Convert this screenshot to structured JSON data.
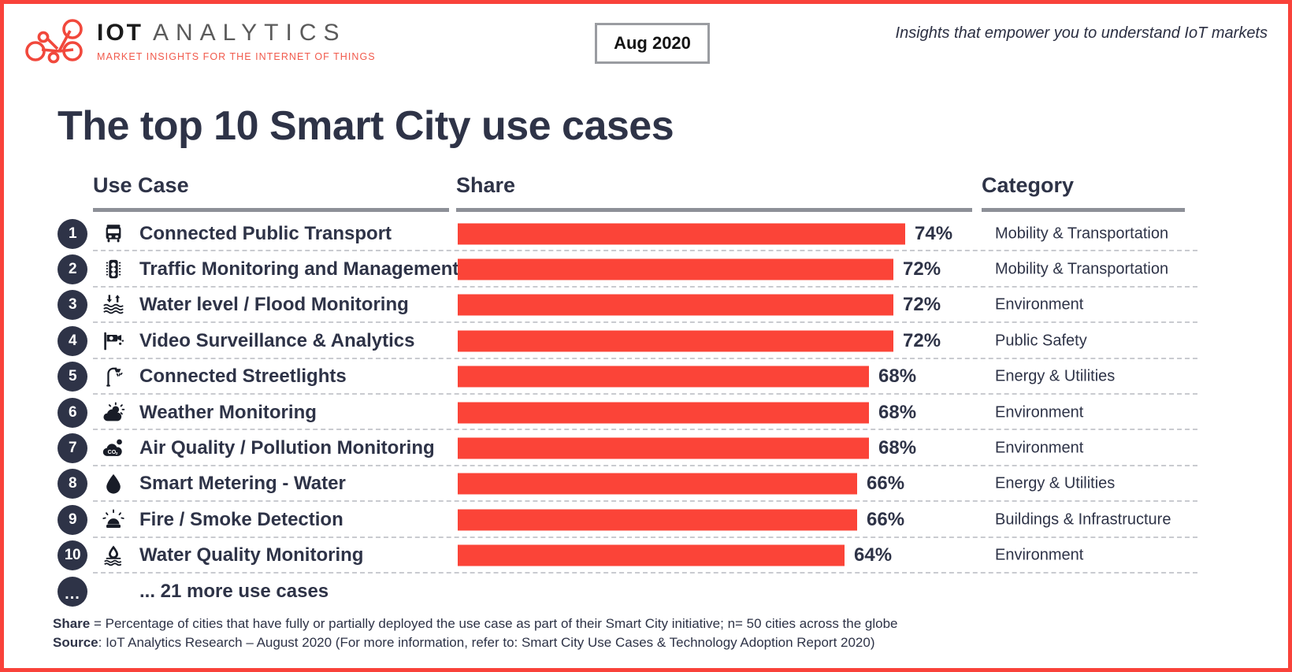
{
  "brand": {
    "logo_title_primary": "IOT",
    "logo_title_secondary": "ANALYTICS",
    "logo_tagline": "MARKET INSIGHTS FOR THE INTERNET OF THINGS",
    "accent_color": "#f9423a",
    "bar_color": "#fb4438",
    "dark_color": "#2e3347"
  },
  "header": {
    "date_badge": "Aug 2020",
    "tagline": "Insights that empower you to understand IoT markets"
  },
  "title": "The top 10 Smart City use cases",
  "columns": {
    "use_case": "Use Case",
    "share": "Share",
    "category": "Category"
  },
  "more_row": {
    "badge": "...",
    "label": "... 21 more use cases"
  },
  "footnotes": [
    {
      "key": "Share",
      "text": " = Percentage of cities that have fully or partially deployed the use case as part of their Smart City initiative; n= 50 cities across the globe"
    },
    {
      "key": "Source",
      "text": ": IoT Analytics Research – August 2020 (For more information, refer to: Smart City Use Cases & Technology Adoption Report 2020)"
    }
  ],
  "chart_data": {
    "type": "bar",
    "title": "The top 10 Smart City use cases",
    "xlabel": "",
    "ylabel": "",
    "xlim": [
      0,
      100
    ],
    "grid": false,
    "legend": false,
    "value_suffix": "%",
    "categories": [
      "Connected Public Transport",
      "Traffic Monitoring and Management",
      "Water level / Flood Monitoring",
      "Video Surveillance & Analytics",
      "Connected Streetlights",
      "Weather Monitoring",
      "Air Quality / Pollution Monitoring",
      "Smart Metering - Water",
      "Fire / Smoke Detection",
      "Water Quality Monitoring"
    ],
    "values": [
      74,
      72,
      72,
      72,
      68,
      68,
      68,
      66,
      66,
      64
    ],
    "value_labels": [
      "74%",
      "72%",
      "72%",
      "72%",
      "68%",
      "68%",
      "68%",
      "66%",
      "66%",
      "64%"
    ],
    "groups": [
      "Mobility & Transportation",
      "Mobility & Transportation",
      "Environment",
      "Public Safety",
      "Energy & Utilities",
      "Environment",
      "Environment",
      "Energy & Utilities",
      "Buildings & Infrastructure",
      "Environment"
    ]
  },
  "rows": [
    {
      "rank": "1",
      "icon": "bus-icon",
      "label": "Connected Public Transport",
      "value": 74,
      "value_label": "74%",
      "category": "Mobility & Transportation"
    },
    {
      "rank": "2",
      "icon": "traffic-light-icon",
      "label": "Traffic Monitoring and Management",
      "value": 72,
      "value_label": "72%",
      "category": "Mobility & Transportation"
    },
    {
      "rank": "3",
      "icon": "water-level-icon",
      "label": "Water level / Flood Monitoring",
      "value": 72,
      "value_label": "72%",
      "category": "Environment"
    },
    {
      "rank": "4",
      "icon": "cctv-camera-icon",
      "label": "Video Surveillance & Analytics",
      "value": 72,
      "value_label": "72%",
      "category": "Public Safety"
    },
    {
      "rank": "5",
      "icon": "streetlight-icon",
      "label": "Connected Streetlights",
      "value": 68,
      "value_label": "68%",
      "category": "Energy & Utilities"
    },
    {
      "rank": "6",
      "icon": "weather-sun-cloud-icon",
      "label": "Weather Monitoring",
      "value": 68,
      "value_label": "68%",
      "category": "Environment"
    },
    {
      "rank": "7",
      "icon": "co2-cloud-icon",
      "label": "Air Quality / Pollution Monitoring",
      "value": 68,
      "value_label": "68%",
      "category": "Environment"
    },
    {
      "rank": "8",
      "icon": "water-drop-icon",
      "label": "Smart Metering - Water",
      "value": 66,
      "value_label": "66%",
      "category": "Energy & Utilities"
    },
    {
      "rank": "9",
      "icon": "siren-alarm-icon",
      "label": "Fire / Smoke Detection",
      "value": 66,
      "value_label": "66%",
      "category": "Buildings & Infrastructure"
    },
    {
      "rank": "10",
      "icon": "water-quality-icon",
      "label": "Water Quality Monitoring",
      "value": 64,
      "value_label": "64%",
      "category": "Environment"
    }
  ]
}
